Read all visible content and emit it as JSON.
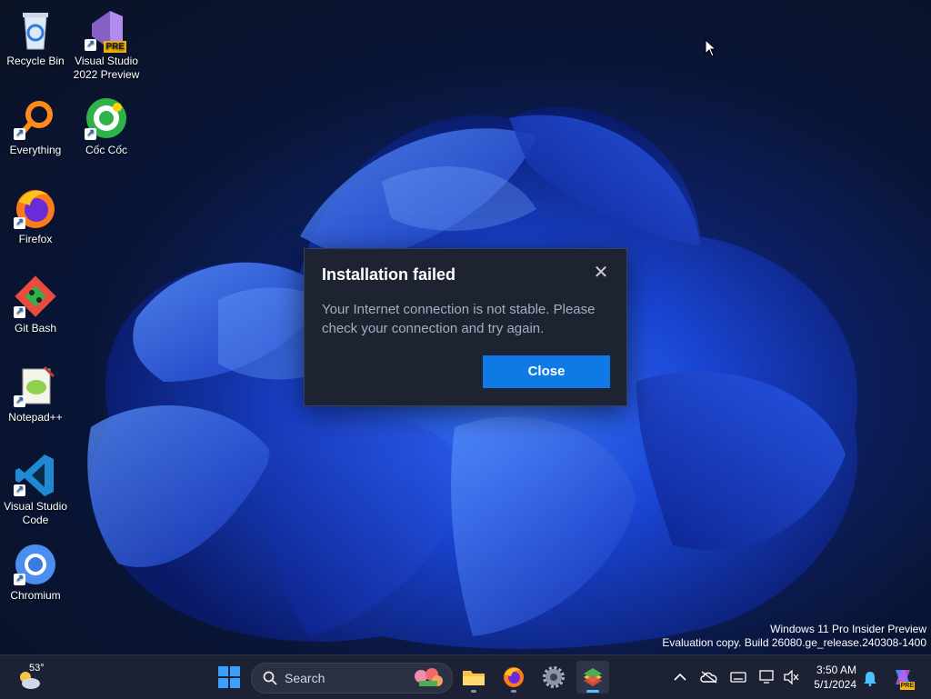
{
  "desktop": {
    "icons": [
      {
        "label": "Recycle Bin"
      },
      {
        "label": "Visual Studio 2022 Preview"
      },
      {
        "label": "Everything"
      },
      {
        "label": "Cốc Cốc"
      },
      {
        "label": "Firefox"
      },
      {
        "label": "Git Bash"
      },
      {
        "label": "Notepad++"
      },
      {
        "label": "Visual Studio Code"
      },
      {
        "label": "Chromium"
      }
    ],
    "vs_badge": "PRE"
  },
  "dialog": {
    "title": "Installation failed",
    "message": "Your Internet connection is not stable. Please check your connection and try again.",
    "close_button": "Close",
    "close_icon": "close-icon"
  },
  "watermark": {
    "line1": "Windows 11 Pro Insider Preview",
    "line2": "Evaluation copy. Build 26080.ge_release.240308-1400"
  },
  "taskbar": {
    "weather_temp": "53°",
    "search_placeholder": "Search",
    "time": "3:50 AM",
    "date": "5/1/2024",
    "copilot_badge": "PRE",
    "accent": "#0f7ae5"
  }
}
